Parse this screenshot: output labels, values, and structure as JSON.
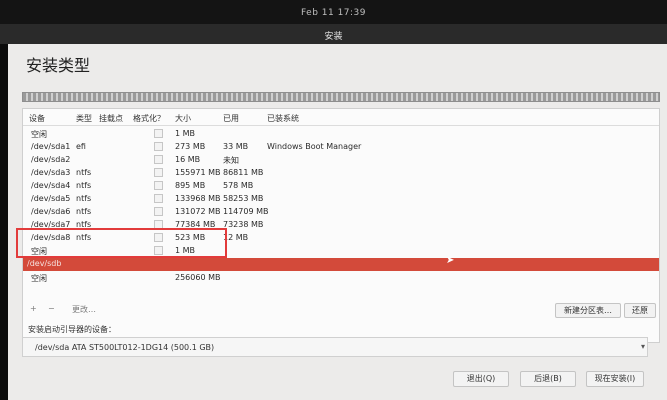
{
  "clock": "Feb 11  17:39",
  "window_title": "安装",
  "page_title": "安装类型",
  "table": {
    "headers": [
      "设备",
      "类型",
      "挂载点",
      "格式化？",
      "大小",
      "已用",
      "已装系统"
    ],
    "rows": [
      {
        "device": "空闲",
        "type": "",
        "mount": "",
        "size": "1 MB",
        "used": "",
        "system": ""
      },
      {
        "device": "/dev/sda1",
        "type": "efi",
        "mount": "",
        "size": "273 MB",
        "used": "33 MB",
        "system": "Windows Boot Manager"
      },
      {
        "device": "/dev/sda2",
        "type": "",
        "mount": "",
        "size": "16 MB",
        "used": "未知",
        "system": ""
      },
      {
        "device": "/dev/sda3",
        "type": "ntfs",
        "mount": "",
        "size": "155971 MB",
        "used": "86811 MB",
        "system": ""
      },
      {
        "device": "/dev/sda4",
        "type": "ntfs",
        "mount": "",
        "size": "895 MB",
        "used": "578 MB",
        "system": ""
      },
      {
        "device": "/dev/sda5",
        "type": "ntfs",
        "mount": "",
        "size": "133968 MB",
        "used": "58253 MB",
        "system": ""
      },
      {
        "device": "/dev/sda6",
        "type": "ntfs",
        "mount": "",
        "size": "131072 MB",
        "used": "114709 MB",
        "system": ""
      },
      {
        "device": "/dev/sda7",
        "type": "ntfs",
        "mount": "",
        "size": "77384 MB",
        "used": "73238 MB",
        "system": ""
      },
      {
        "device": "/dev/sda8",
        "type": "ntfs",
        "mount": "",
        "size": "523 MB",
        "used": "12 MB",
        "system": ""
      },
      {
        "device": "空闲",
        "type": "",
        "mount": "",
        "size": "1 MB",
        "used": "",
        "system": ""
      }
    ],
    "disk_row": {
      "device": "/dev/sdb"
    },
    "free_row": {
      "device": "空闲",
      "size": "256060 MB"
    }
  },
  "toolbar": {
    "add": "+",
    "remove": "−",
    "change": "更改…",
    "new_table": "新建分区表…",
    "revert": "还原"
  },
  "boot": {
    "label": "安装启动引导器的设备：",
    "value": "/dev/sda   ATA ST500LT012-1DG14 (500.1 GB)"
  },
  "buttons": {
    "quit": "退出(Q)",
    "back": "后退(B)",
    "install": "现在安装(I)"
  },
  "colors": {
    "selected_row": "#d34a3a",
    "highlight_box": "#e23b3b"
  }
}
